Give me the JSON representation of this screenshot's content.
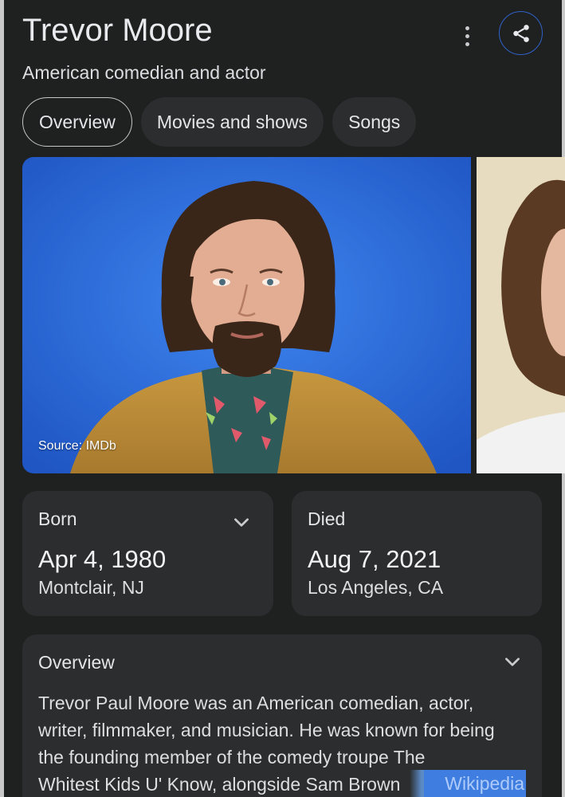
{
  "header": {
    "title": "Trevor Moore",
    "subtitle": "American comedian and actor"
  },
  "tabs": [
    {
      "label": "Overview",
      "active": true
    },
    {
      "label": "Movies and shows",
      "active": false
    },
    {
      "label": "Songs",
      "active": false
    }
  ],
  "photos": {
    "main_source": "Source: IMDb"
  },
  "born": {
    "label": "Born",
    "date": "Apr 4, 1980",
    "place": "Montclair, NJ"
  },
  "died": {
    "label": "Died",
    "date": "Aug 7, 2021",
    "place": "Los Angeles, CA"
  },
  "overview": {
    "title": "Overview",
    "lines": [
      "Trevor Paul Moore was an American comedian, actor,",
      "writer, filmmaker, and musician. He was known for being",
      "the founding member of the comedy troupe The",
      "Whitest Kids U' Know, alongside Sam Brown"
    ],
    "source_link": "Wikipedia"
  },
  "colors": {
    "background": "#1f2020",
    "card": "#2b2d2e",
    "accent_ring": "#2f62c8",
    "photo_bg": "#2f6fe0"
  },
  "icons": {
    "more": "more-vert-icon",
    "share": "share-icon",
    "expand": "chevron-down-icon"
  }
}
